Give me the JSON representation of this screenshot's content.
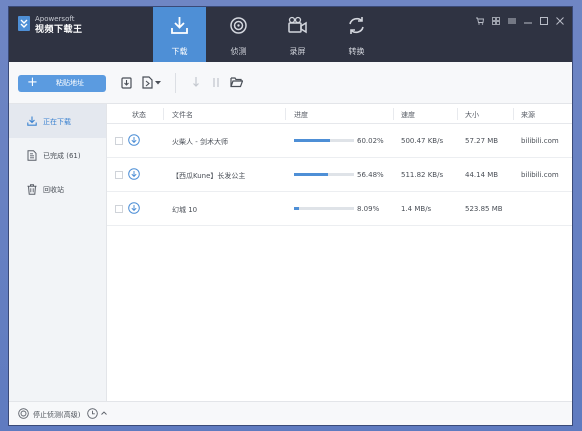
{
  "app": {
    "brand_small": "Apowersoft",
    "brand_name": "视频下载王"
  },
  "nav": {
    "tabs": [
      {
        "label": "下载",
        "icon": "download-icon",
        "active": true
      },
      {
        "label": "侦测",
        "icon": "detect-icon",
        "active": false
      },
      {
        "label": "录屏",
        "icon": "record-icon",
        "active": false
      },
      {
        "label": "转换",
        "icon": "convert-icon",
        "active": false
      }
    ]
  },
  "toolbar": {
    "paste_label": "粘贴地址"
  },
  "sidebar": {
    "items": [
      {
        "label": "正在下载",
        "icon": "download-icon",
        "active": true
      },
      {
        "label": "已完成 (61)",
        "icon": "completed-icon",
        "active": false
      },
      {
        "label": "回收站",
        "icon": "trash-icon",
        "active": false
      }
    ]
  },
  "table": {
    "headers": {
      "status": "状态",
      "filename": "文件名",
      "progress": "进度",
      "speed": "速度",
      "size": "大小",
      "source": "来源"
    },
    "rows": [
      {
        "filename": "火柴人 - 剑术大师",
        "progress": 0.6002,
        "progress_text": "60.02%",
        "speed": "500.47 KB/s",
        "size": "57.27 MB",
        "source": "bilibili.com"
      },
      {
        "filename": "【西瓜Kune】长发公主",
        "progress": 0.5648,
        "progress_text": "56.48%",
        "speed": "511.82 KB/s",
        "size": "44.14 MB",
        "source": "bilibili.com"
      },
      {
        "filename": "幻城 10",
        "progress": 0.0809,
        "progress_text": "8.09%",
        "speed": "1.4 MB/s",
        "size": "523.85 MB",
        "source": ""
      }
    ]
  },
  "statusbar": {
    "label": "停止侦测(高级)"
  },
  "colors": {
    "accent": "#4e8fd6",
    "titlebar": "#2f3342"
  }
}
